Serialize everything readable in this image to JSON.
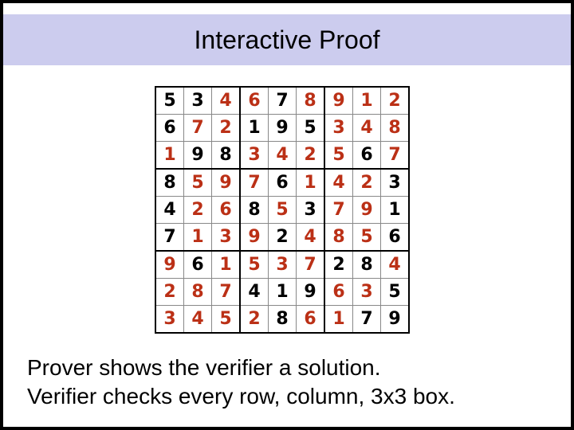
{
  "title": "Interactive Proof",
  "caption_line1": "Prover shows the verifier a solution.",
  "caption_line2": "Verifier checks every row, column, 3x3 box.",
  "sudoku": {
    "rows": [
      [
        {
          "v": "5",
          "g": true
        },
        {
          "v": "3",
          "g": true
        },
        {
          "v": "4",
          "g": false
        },
        {
          "v": "6",
          "g": false
        },
        {
          "v": "7",
          "g": true
        },
        {
          "v": "8",
          "g": false
        },
        {
          "v": "9",
          "g": false
        },
        {
          "v": "1",
          "g": false
        },
        {
          "v": "2",
          "g": false
        }
      ],
      [
        {
          "v": "6",
          "g": true
        },
        {
          "v": "7",
          "g": false
        },
        {
          "v": "2",
          "g": false
        },
        {
          "v": "1",
          "g": true
        },
        {
          "v": "9",
          "g": true
        },
        {
          "v": "5",
          "g": true
        },
        {
          "v": "3",
          "g": false
        },
        {
          "v": "4",
          "g": false
        },
        {
          "v": "8",
          "g": false
        }
      ],
      [
        {
          "v": "1",
          "g": false
        },
        {
          "v": "9",
          "g": true
        },
        {
          "v": "8",
          "g": true
        },
        {
          "v": "3",
          "g": false
        },
        {
          "v": "4",
          "g": false
        },
        {
          "v": "2",
          "g": false
        },
        {
          "v": "5",
          "g": false
        },
        {
          "v": "6",
          "g": true
        },
        {
          "v": "7",
          "g": false
        }
      ],
      [
        {
          "v": "8",
          "g": true
        },
        {
          "v": "5",
          "g": false
        },
        {
          "v": "9",
          "g": false
        },
        {
          "v": "7",
          "g": false
        },
        {
          "v": "6",
          "g": true
        },
        {
          "v": "1",
          "g": false
        },
        {
          "v": "4",
          "g": false
        },
        {
          "v": "2",
          "g": false
        },
        {
          "v": "3",
          "g": true
        }
      ],
      [
        {
          "v": "4",
          "g": true
        },
        {
          "v": "2",
          "g": false
        },
        {
          "v": "6",
          "g": false
        },
        {
          "v": "8",
          "g": true
        },
        {
          "v": "5",
          "g": false
        },
        {
          "v": "3",
          "g": true
        },
        {
          "v": "7",
          "g": false
        },
        {
          "v": "9",
          "g": false
        },
        {
          "v": "1",
          "g": true
        }
      ],
      [
        {
          "v": "7",
          "g": true
        },
        {
          "v": "1",
          "g": false
        },
        {
          "v": "3",
          "g": false
        },
        {
          "v": "9",
          "g": false
        },
        {
          "v": "2",
          "g": true
        },
        {
          "v": "4",
          "g": false
        },
        {
          "v": "8",
          "g": false
        },
        {
          "v": "5",
          "g": false
        },
        {
          "v": "6",
          "g": true
        }
      ],
      [
        {
          "v": "9",
          "g": false
        },
        {
          "v": "6",
          "g": true
        },
        {
          "v": "1",
          "g": false
        },
        {
          "v": "5",
          "g": false
        },
        {
          "v": "3",
          "g": false
        },
        {
          "v": "7",
          "g": false
        },
        {
          "v": "2",
          "g": true
        },
        {
          "v": "8",
          "g": true
        },
        {
          "v": "4",
          "g": false
        }
      ],
      [
        {
          "v": "2",
          "g": false
        },
        {
          "v": "8",
          "g": false
        },
        {
          "v": "7",
          "g": false
        },
        {
          "v": "4",
          "g": true
        },
        {
          "v": "1",
          "g": true
        },
        {
          "v": "9",
          "g": true
        },
        {
          "v": "6",
          "g": false
        },
        {
          "v": "3",
          "g": false
        },
        {
          "v": "5",
          "g": true
        }
      ],
      [
        {
          "v": "3",
          "g": false
        },
        {
          "v": "4",
          "g": false
        },
        {
          "v": "5",
          "g": false
        },
        {
          "v": "2",
          "g": false
        },
        {
          "v": "8",
          "g": true
        },
        {
          "v": "6",
          "g": false
        },
        {
          "v": "1",
          "g": false
        },
        {
          "v": "7",
          "g": true
        },
        {
          "v": "9",
          "g": true
        }
      ]
    ]
  }
}
